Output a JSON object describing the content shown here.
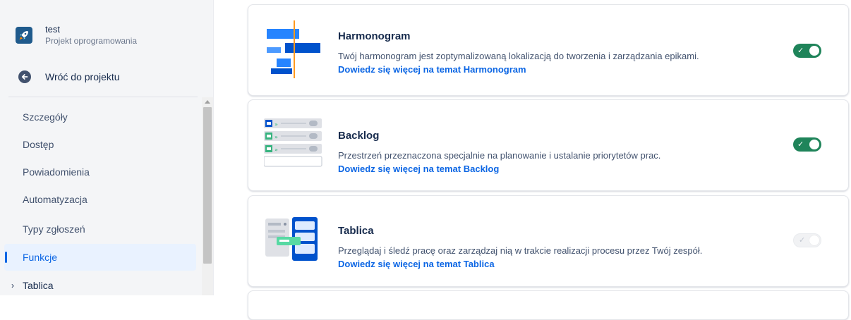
{
  "project": {
    "name": "test",
    "type": "Projekt oprogramowania",
    "back_label": "Wróć do projektu"
  },
  "nav": {
    "items": [
      {
        "label": "Szczegóły"
      },
      {
        "label": "Dostęp"
      },
      {
        "label": "Powiadomienia"
      },
      {
        "label": "Automatyzacja"
      },
      {
        "label": "Typy zgłoszeń"
      },
      {
        "label": "Funkcje",
        "active": true
      }
    ],
    "expandable": {
      "label": "Tablica",
      "chevron": "chevron-right-icon"
    }
  },
  "features": [
    {
      "title": "Harmonogram",
      "description": "Twój harmonogram jest zoptymalizowaną lokalizacją do tworzenia i zarządzania epikami.",
      "link": "Dowiedz się więcej na temat Harmonogram",
      "enabled": true
    },
    {
      "title": "Backlog",
      "description": "Przestrzeń przeznaczona specjalnie na planowanie i ustalanie priorytetów prac.",
      "link": "Dowiedz się więcej na temat Backlog",
      "enabled": true
    },
    {
      "title": "Tablica",
      "description": "Przeglądaj i śledź pracę oraz zarządzaj nią w trakcie realizacji procesu przez Twój zespół.",
      "link": "Dowiedz się więcej na temat Tablica",
      "enabled": false
    }
  ],
  "colors": {
    "accent": "#0c66e4",
    "toggle_on": "#1f845a",
    "sidebar_bg": "#f4f5f7",
    "active_bg": "#e9f2ff"
  }
}
